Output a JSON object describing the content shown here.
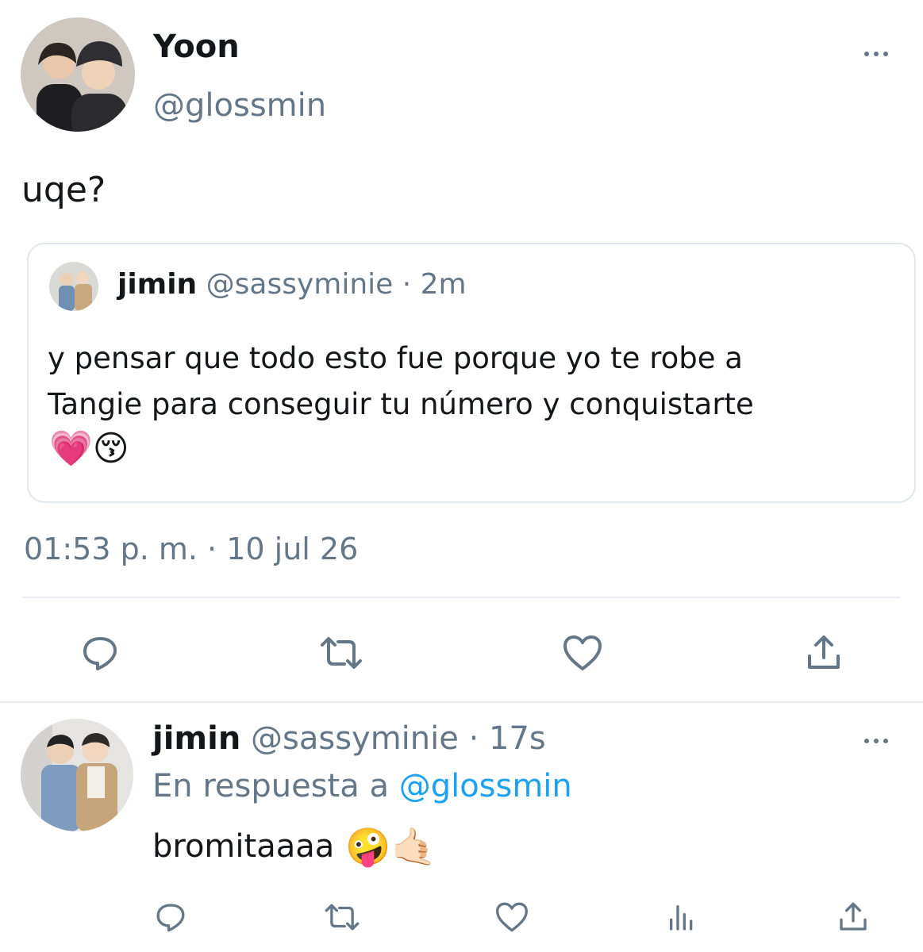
{
  "main_tweet": {
    "display_name": "Yoon",
    "handle": "@glossmin",
    "text": "uqe?",
    "timestamp": "01:53 p. m. · 10 jul 26"
  },
  "quoted_tweet": {
    "display_name": "jimin",
    "handle": "@sassyminie",
    "age": "· 2m",
    "text_line1": "y pensar que todo esto fue porque yo te robe a",
    "text_line2": "Tangie para conseguir tu número y conquistarte",
    "emojis": "💗😚"
  },
  "reply": {
    "display_name": "jimin",
    "handle": "@sassyminie",
    "age": "· 17s",
    "reply_to_prefix": "En respuesta a",
    "reply_to_handle": "@glossmin",
    "text": "bromitaaaa",
    "emojis": "🤪🤙🏻"
  },
  "action_icons": [
    "reply-icon",
    "retweet-icon",
    "like-icon",
    "share-icon"
  ],
  "reply_action_icons": [
    "reply-icon",
    "retweet-icon",
    "like-icon",
    "analytics-icon",
    "share-icon"
  ],
  "colors": {
    "muted": "#657786",
    "link": "#1da1f2",
    "border": "#e1e8ed"
  }
}
